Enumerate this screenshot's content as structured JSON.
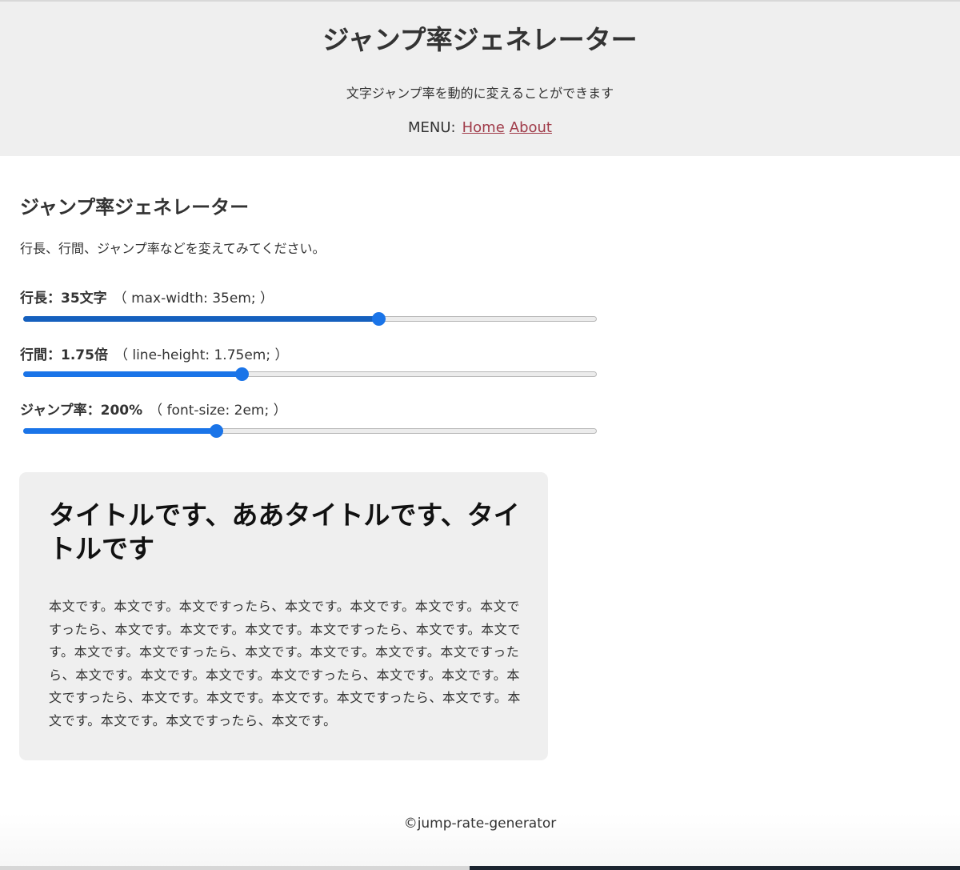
{
  "header": {
    "title": "ジャンプ率ジェネレーター",
    "description": "文字ジャンプ率を動的に変えることができます",
    "menu_label": "MENU:",
    "menu_items": [
      {
        "label": "Home"
      },
      {
        "label": "About"
      }
    ]
  },
  "main": {
    "heading": "ジャンプ率ジェネレーター",
    "intro": "行長、行間、ジャンプ率などを変えてみてください。"
  },
  "controls": {
    "line_length": {
      "label": "行長：35文字",
      "css": "（ max-width: 35em; ）",
      "level_fraction": 0.62
    },
    "line_height": {
      "label": "行間：1.75倍",
      "css": "（ line-height: 1.75em; ）",
      "level_fraction": 0.38
    },
    "jump_rate": {
      "label": "ジャンプ率：200%",
      "css": "（ font-size: 2em; ）",
      "level_fraction": 0.335
    }
  },
  "preview": {
    "title": "タイトルです、ああタイトルです、タイトルです",
    "body": "本文です。本文です。本文ですったら、本文です。本文です。本文です。本文ですったら、本文です。本文です。本文です。本文ですったら、本文です。本文です。本文です。本文ですったら、本文です。本文です。本文です。本文ですったら、本文です。本文です。本文です。本文ですったら、本文です。本文です。本文ですったら、本文です。本文です。本文です。本文ですったら、本文です。本文です。本文です。本文ですったら、本文です。"
  },
  "footer": {
    "copyright": "©jump-rate-generator"
  },
  "colors": {
    "accent": "#1a74e8",
    "link": "#a03c4a",
    "header_bg": "#efefef",
    "preview_bg": "#efefef"
  }
}
